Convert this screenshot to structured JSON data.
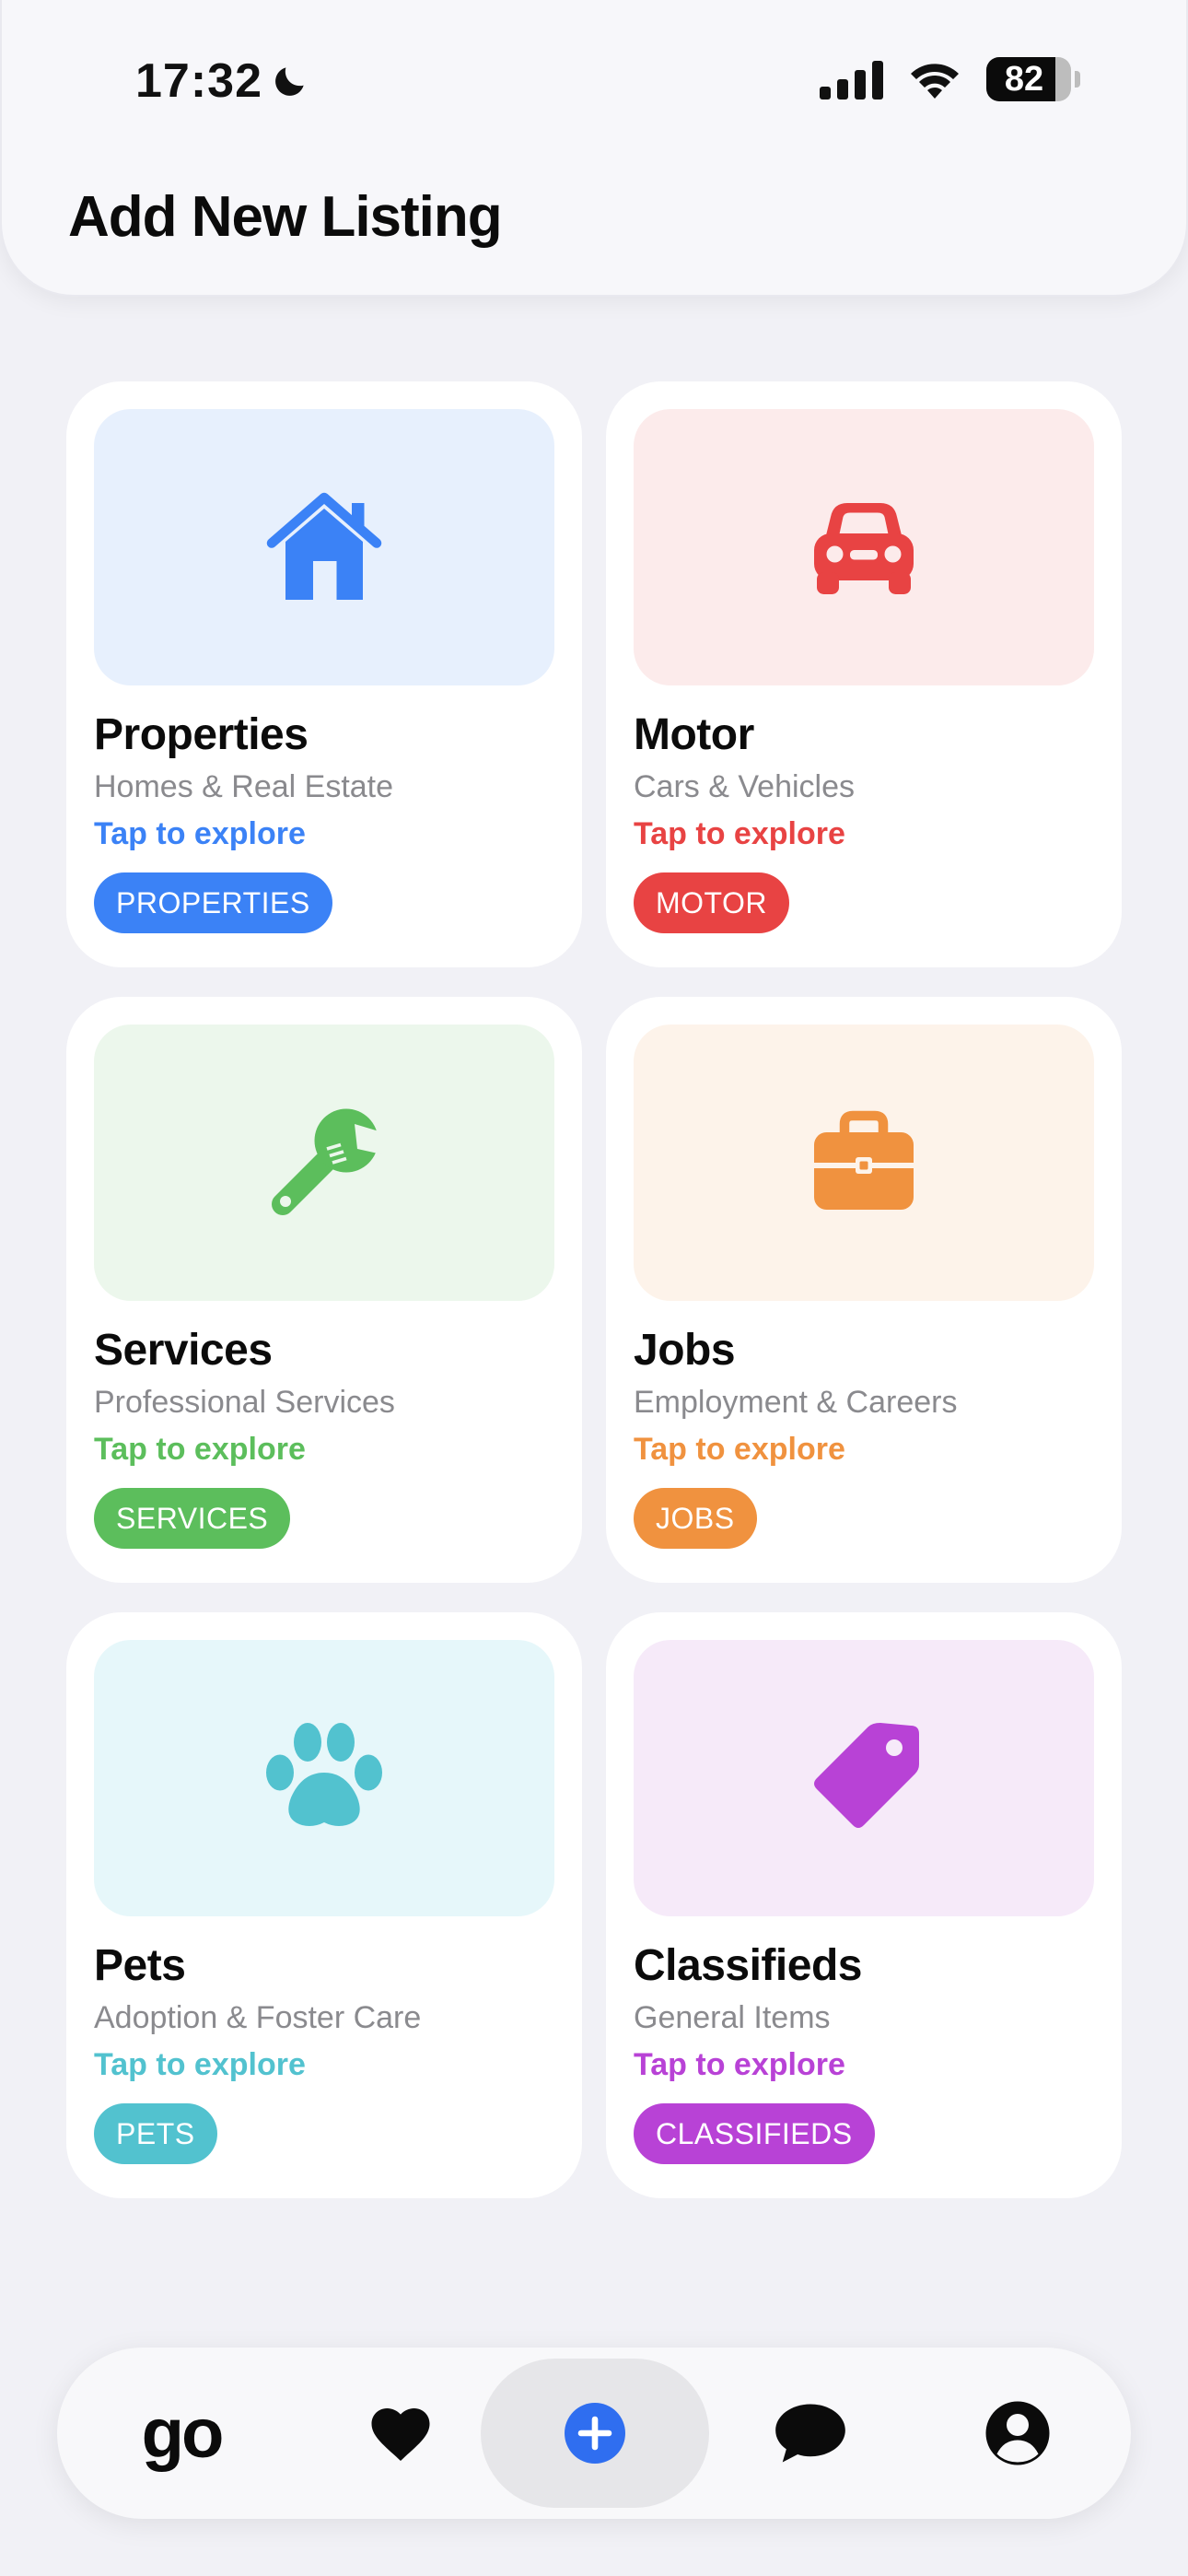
{
  "status_bar": {
    "time": "17:32",
    "battery": "82"
  },
  "header": {
    "title": "Add New Listing"
  },
  "categories": [
    {
      "name": "Properties",
      "subtitle": "Homes & Real Estate",
      "cta": "Tap to explore",
      "tag": "PROPERTIES",
      "icon": "house-icon",
      "color": "#3b82f6",
      "bg": "#e7f0fd"
    },
    {
      "name": "Motor",
      "subtitle": "Cars & Vehicles",
      "cta": "Tap to explore",
      "tag": "MOTOR",
      "icon": "car-icon",
      "color": "#e84343",
      "bg": "#fcebeb"
    },
    {
      "name": "Services",
      "subtitle": "Professional Services",
      "cta": "Tap to explore",
      "tag": "SERVICES",
      "icon": "wrench-icon",
      "color": "#5cbe5c",
      "bg": "#ecf7ec"
    },
    {
      "name": "Jobs",
      "subtitle": "Employment & Careers",
      "cta": "Tap to explore",
      "tag": "JOBS",
      "icon": "briefcase-icon",
      "color": "#f0923f",
      "bg": "#fdf3ea"
    },
    {
      "name": "Pets",
      "subtitle": "Adoption & Foster Care",
      "cta": "Tap to explore",
      "tag": "PETS",
      "icon": "paw-icon",
      "color": "#52c2cf",
      "bg": "#e6f7fa"
    },
    {
      "name": "Classifieds",
      "subtitle": "General Items",
      "cta": "Tap to explore",
      "tag": "CLASSIFIEDS",
      "icon": "tag-icon",
      "color": "#b842d6",
      "bg": "#f6eaf9"
    }
  ],
  "tabbar": {
    "home_logo": "go"
  }
}
